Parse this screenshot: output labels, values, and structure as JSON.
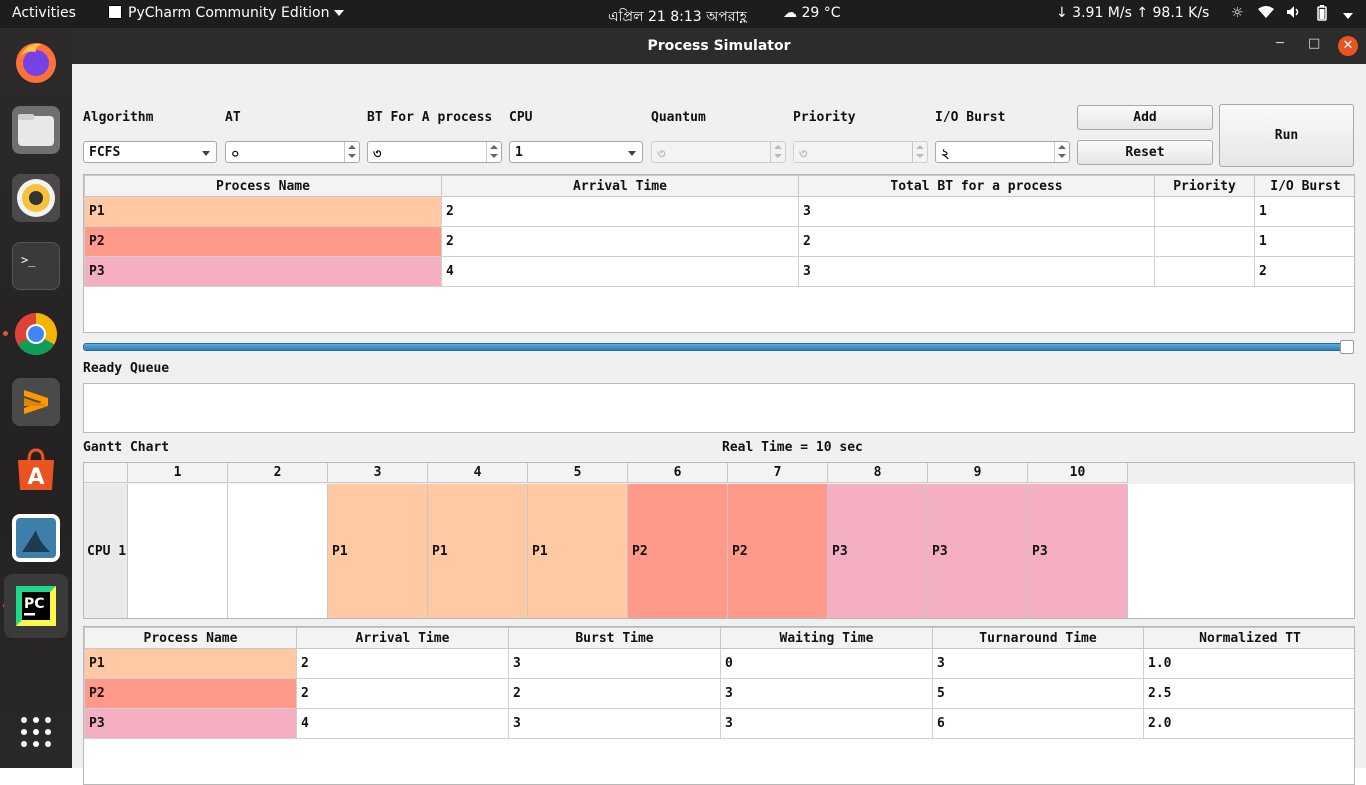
{
  "topbar": {
    "activities": "Activities",
    "app_name": "PyCharm Community Edition",
    "clock": "এপ্রিল 21  8:13 অপরাহ্ণ",
    "weather": "29 °C",
    "network_speed": "↓ 3.91 M/s ↑ 98.1 K/s"
  },
  "dock": {
    "apps": [
      "Firefox",
      "Files",
      "Rhythmbox",
      "Terminal",
      "Chrome",
      "Sublime Text",
      "Ubuntu Software",
      "Shotwell",
      "PyCharm",
      "Show Applications"
    ]
  },
  "window": {
    "title": "Process Simulator"
  },
  "form": {
    "algorithm_label": "Algorithm",
    "algorithm_value": "FCFS",
    "at_label": "AT",
    "at_value": "০",
    "bt_label": "BT For A process",
    "bt_value": "৩",
    "cpu_label": "CPU",
    "cpu_value": "1",
    "quantum_label": "Quantum",
    "quantum_value": "৩",
    "priority_label": "Priority",
    "priority_value": "৩",
    "io_label": "I/O Burst",
    "io_value": "২",
    "add_label": "Add",
    "reset_label": "Reset",
    "run_label": "Run"
  },
  "process_table": {
    "headers": [
      "Process Name",
      "Arrival Time",
      "Total BT for a process",
      "Priority",
      "I/O Burst"
    ],
    "rows": [
      {
        "name": "P1",
        "arrival": "2",
        "bt": "3",
        "priority": "",
        "io": "1",
        "color": "#ffc9a4"
      },
      {
        "name": "P2",
        "arrival": "2",
        "bt": "2",
        "priority": "",
        "io": "1",
        "color": "#ff9a8a"
      },
      {
        "name": "P3",
        "arrival": "4",
        "bt": "3",
        "priority": "",
        "io": "2",
        "color": "#f4b0c2"
      }
    ]
  },
  "progress": {
    "value_percent": 100
  },
  "ready_queue": {
    "label": "Ready Queue"
  },
  "gantt": {
    "label": "Gantt Chart",
    "real_time": "Real Time = 10 sec",
    "cpu_label": "CPU 1",
    "time_slots": [
      "1",
      "2",
      "3",
      "4",
      "5",
      "6",
      "7",
      "8",
      "9",
      "10"
    ],
    "cells": [
      {
        "text": "",
        "color": "#ffffff"
      },
      {
        "text": "",
        "color": "#ffffff"
      },
      {
        "text": "P1",
        "color": "#ffc9a4"
      },
      {
        "text": "P1",
        "color": "#ffc9a4"
      },
      {
        "text": "P1",
        "color": "#ffc9a4"
      },
      {
        "text": "P2",
        "color": "#ff9a8a"
      },
      {
        "text": "P2",
        "color": "#ff9a8a"
      },
      {
        "text": "P3",
        "color": "#f4b0c2"
      },
      {
        "text": "P3",
        "color": "#f4b0c2"
      },
      {
        "text": "P3",
        "color": "#f4b0c2"
      }
    ]
  },
  "result_table": {
    "headers": [
      "Process Name",
      "Arrival Time",
      "Burst Time",
      "Waiting Time",
      "Turnaround Time",
      "Normalized TT"
    ],
    "rows": [
      {
        "name": "P1",
        "arrival": "2",
        "burst": "3",
        "waiting": "0",
        "turnaround": "3",
        "ntt": "1.0",
        "color": "#ffc9a4"
      },
      {
        "name": "P2",
        "arrival": "2",
        "burst": "2",
        "waiting": "3",
        "turnaround": "5",
        "ntt": "2.5",
        "color": "#ff9a8a"
      },
      {
        "name": "P3",
        "arrival": "4",
        "burst": "3",
        "waiting": "3",
        "turnaround": "6",
        "ntt": "2.0",
        "color": "#f4b0c2"
      }
    ]
  },
  "colors": {
    "p1": "#ffc9a4",
    "p2": "#ff9a8a",
    "p3": "#f4b0c2",
    "accent": "#e95420"
  }
}
